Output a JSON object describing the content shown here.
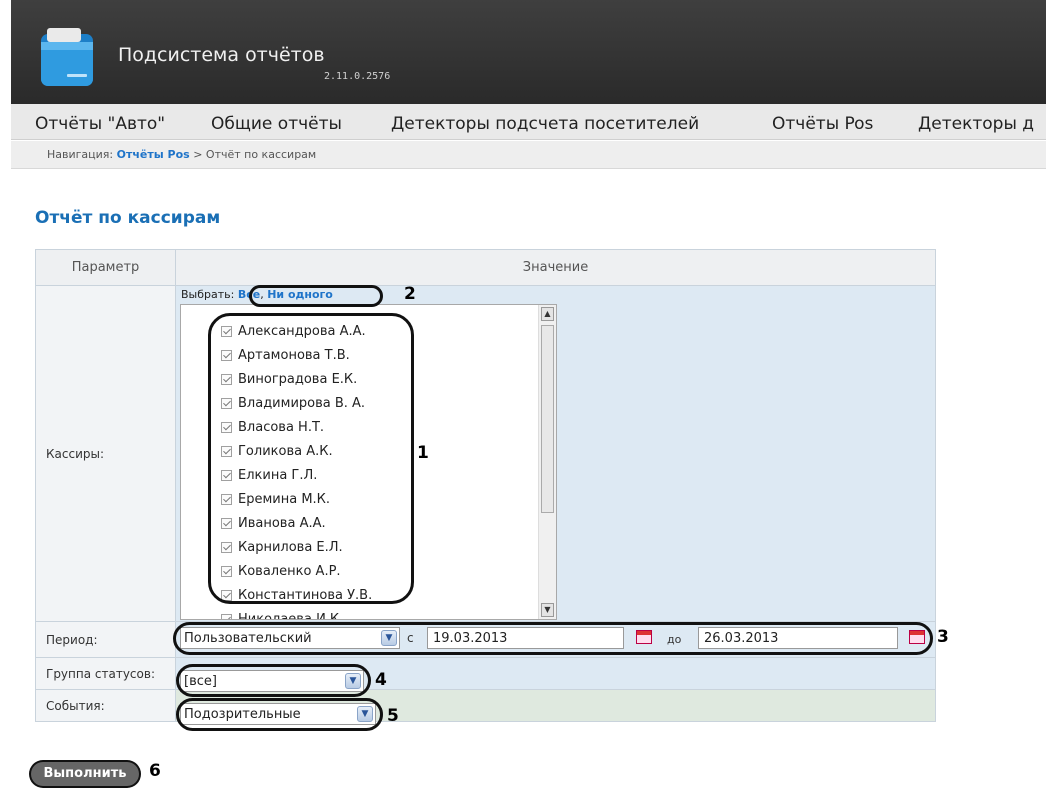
{
  "app": {
    "title": "Подсистема отчётов",
    "version": "2.11.0.2576",
    "logo_icon": "folder-icon"
  },
  "menu": {
    "items": [
      {
        "label": "Отчёты \"Авто\""
      },
      {
        "label": "Общие отчёты"
      },
      {
        "label": "Детекторы подсчета посетителей"
      },
      {
        "label": "Отчёты Pos"
      },
      {
        "label": "Детекторы д"
      }
    ]
  },
  "breadcrumb": {
    "prefix": "Навигация:",
    "link": "Отчёты Pos",
    "separator": ">",
    "current": "Отчёт по кассирам"
  },
  "page": {
    "title": "Отчёт по кассирам"
  },
  "table": {
    "headers": {
      "param": "Параметр",
      "value": "Значение"
    },
    "cashiers": {
      "label": "Кассиры:",
      "pick_label": "Выбрать:",
      "pick_all": "Все",
      "pick_sep": ",",
      "pick_none": "Ни одного",
      "items": [
        "Александрова А.А.",
        "Артамонова Т.В.",
        "Виноградова Е.К.",
        "Владимирова В. А.",
        "Власова Н.Т.",
        "Голикова А.К.",
        "Елкина Г.Л.",
        "Еремина М.К.",
        "Иванова А.А.",
        "Карнилова Е.Л.",
        "Коваленко А.Р.",
        "Константинова У.В.",
        "Николаева И.К."
      ]
    },
    "period": {
      "label": "Период:",
      "selected": "Пользовательский",
      "from_label": "с",
      "from_date": "19.03.2013",
      "to_label": "до",
      "to_date": "26.03.2013"
    },
    "status_group": {
      "label": "Группа статусов:",
      "selected": "[все]"
    },
    "events": {
      "label": "События:",
      "selected": "Подозрительные"
    }
  },
  "run_button": {
    "label": "Выполнить"
  },
  "callouts": [
    "1",
    "2",
    "3",
    "4",
    "5",
    "6"
  ]
}
